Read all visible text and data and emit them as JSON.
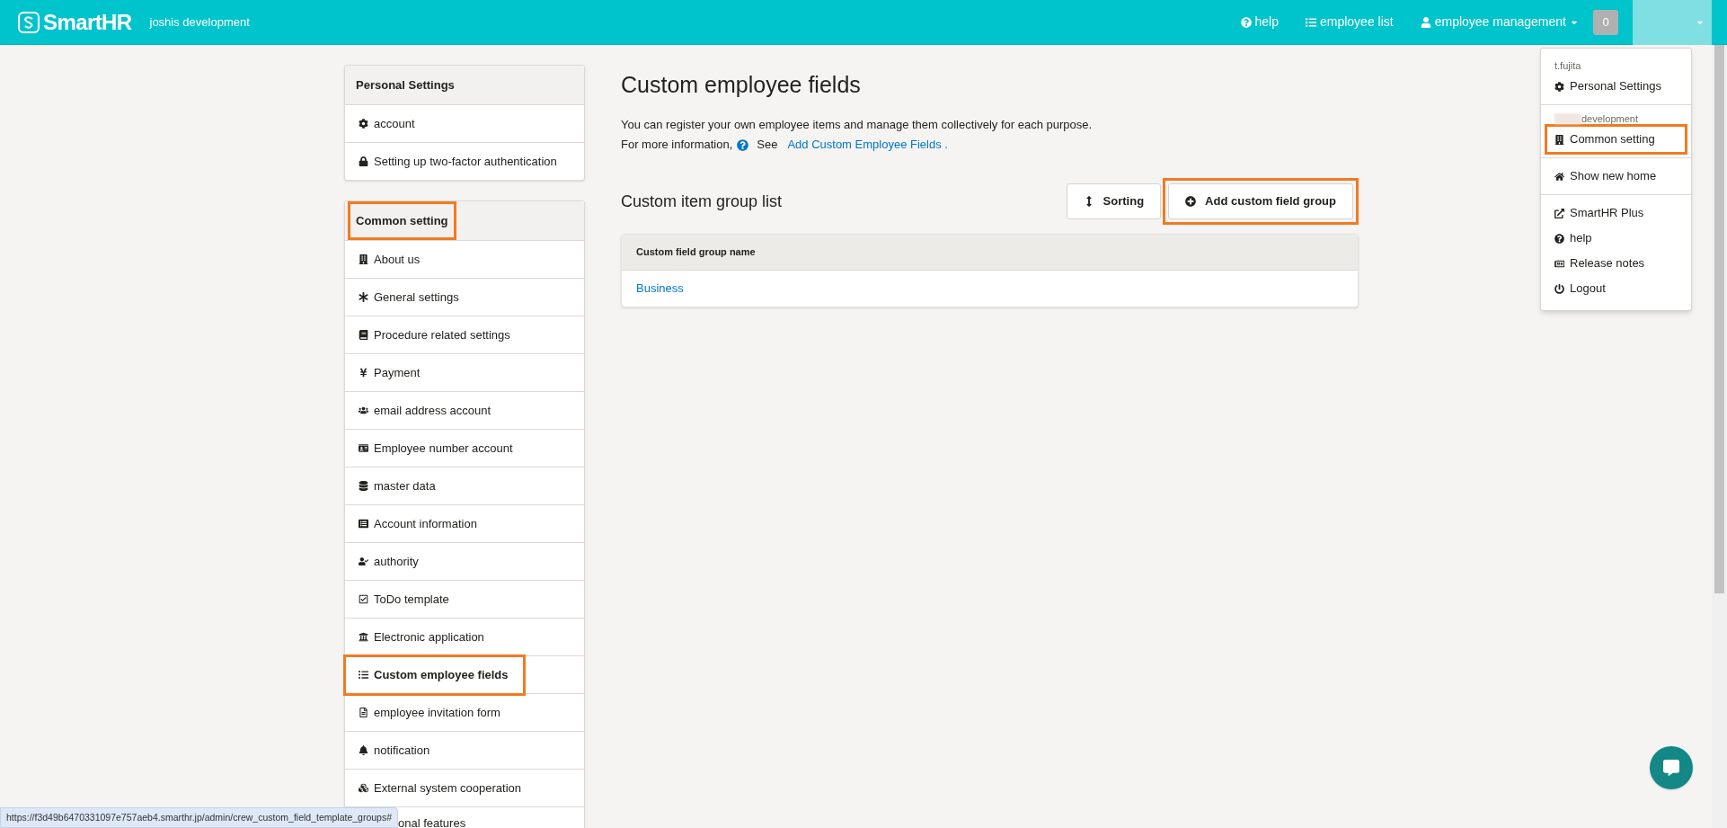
{
  "header": {
    "logo": "SmartHR",
    "company": "joshis development",
    "nav": [
      {
        "label": "help",
        "caret": false
      },
      {
        "label": "employee list",
        "caret": false
      },
      {
        "label": "employee management",
        "caret": true
      }
    ],
    "badge": "0",
    "user_menu_open": true
  },
  "sidebar": {
    "sections": [
      {
        "title": "Personal Settings",
        "highlighted": false,
        "items": [
          {
            "label": "account",
            "selected": false,
            "highlighted": false,
            "partly_hidden": false
          },
          {
            "label": "Setting up two-factor authentication",
            "selected": false,
            "highlighted": false,
            "partly_hidden": false
          }
        ]
      },
      {
        "title": "Common setting",
        "highlighted": true,
        "items": [
          {
            "label": "About us",
            "selected": false,
            "highlighted": false,
            "partly_hidden": false
          },
          {
            "label": "General settings",
            "selected": false,
            "highlighted": false,
            "partly_hidden": false
          },
          {
            "label": "Procedure related settings",
            "selected": false,
            "highlighted": false,
            "partly_hidden": false
          },
          {
            "label": "Payment",
            "selected": false,
            "highlighted": false,
            "partly_hidden": false
          },
          {
            "label": "email address account",
            "selected": false,
            "highlighted": false,
            "partly_hidden": false
          },
          {
            "label": "Employee number account",
            "selected": false,
            "highlighted": false,
            "partly_hidden": false
          },
          {
            "label": "master data",
            "selected": false,
            "highlighted": false,
            "partly_hidden": false
          },
          {
            "label": "Account information",
            "selected": false,
            "highlighted": false,
            "partly_hidden": false
          },
          {
            "label": "authority",
            "selected": false,
            "highlighted": false,
            "partly_hidden": false
          },
          {
            "label": "ToDo template",
            "selected": false,
            "highlighted": false,
            "partly_hidden": false
          },
          {
            "label": "Electronic application",
            "selected": false,
            "highlighted": false,
            "partly_hidden": false
          },
          {
            "label": "Custom employee fields",
            "selected": true,
            "highlighted": true,
            "partly_hidden": false
          },
          {
            "label": "employee invitation form",
            "selected": false,
            "highlighted": false,
            "partly_hidden": false
          },
          {
            "label": "notification",
            "selected": false,
            "highlighted": false,
            "partly_hidden": false
          },
          {
            "label": "External system cooperation",
            "selected": false,
            "highlighted": false,
            "partly_hidden": false
          },
          {
            "label": "onal features",
            "selected": false,
            "highlighted": false,
            "partly_hidden": true
          }
        ]
      }
    ]
  },
  "main": {
    "title": "Custom employee fields",
    "description": "You can register your own employee items and manage them collectively for each purpose.",
    "info_prefix": "For more information,",
    "info_see": "See",
    "info_link": "Add Custom Employee Fields .",
    "list_title": "Custom item group list",
    "buttons": [
      {
        "label": "Sorting",
        "highlighted": false
      },
      {
        "label": "Add custom field group",
        "highlighted": true
      }
    ],
    "table": {
      "columns": [
        "Custom field group name"
      ],
      "rows": [
        [
          "Business"
        ]
      ]
    }
  },
  "user_menu": {
    "sections": [
      {
        "caption": "t.fujita",
        "redacted": false,
        "items": [
          {
            "label": "Personal Settings",
            "highlighted": false
          }
        ]
      },
      {
        "caption": "development",
        "redacted": true,
        "items": [
          {
            "label": "Common setting",
            "highlighted": true
          }
        ]
      },
      {
        "items": [
          {
            "label": "Show new home",
            "highlighted": false
          }
        ]
      },
      {
        "items": [
          {
            "label": "SmartHR Plus",
            "highlighted": false
          },
          {
            "label": "help",
            "highlighted": false
          },
          {
            "label": "Release notes",
            "highlighted": false
          },
          {
            "label": "Logout",
            "highlighted": false
          }
        ]
      }
    ]
  },
  "status_bar": {
    "url": "https://f3d49b6470331097e757aeb4.smarthr.jp/admin/crew_custom_field_template_groups#"
  }
}
